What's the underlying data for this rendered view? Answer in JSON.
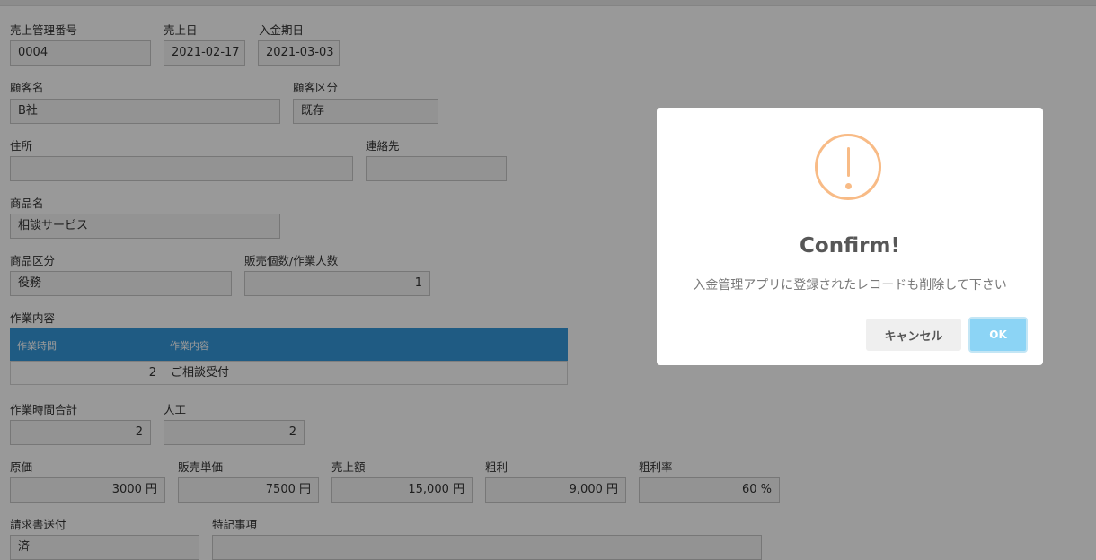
{
  "form": {
    "sales_no": {
      "label": "売上管理番号",
      "value": "0004"
    },
    "sales_date": {
      "label": "売上日",
      "value": "2021-02-17"
    },
    "due_date": {
      "label": "入金期日",
      "value": "2021-03-03"
    },
    "customer_name": {
      "label": "顧客名",
      "value": "B社"
    },
    "customer_type": {
      "label": "顧客区分",
      "value": "既存"
    },
    "address": {
      "label": "住所",
      "value": ""
    },
    "contact": {
      "label": "連絡先",
      "value": ""
    },
    "product_name": {
      "label": "商品名",
      "value": "相談サービス"
    },
    "product_type": {
      "label": "商品区分",
      "value": "役務"
    },
    "quantity": {
      "label": "販売個数/作業人数",
      "value": "1"
    },
    "work_section_label": "作業内容",
    "work_table": {
      "headers": [
        "作業時間",
        "作業内容"
      ],
      "rows": [
        {
          "hours": "2",
          "content": "ご相談受付"
        }
      ]
    },
    "total_hours": {
      "label": "作業時間合計",
      "value": "2"
    },
    "man_days": {
      "label": "人工",
      "value": "2"
    },
    "cost": {
      "label": "原価",
      "value": "3000 円"
    },
    "unit_price": {
      "label": "販売単価",
      "value": "7500 円"
    },
    "sales_amount": {
      "label": "売上額",
      "value": "15,000 円"
    },
    "gross_profit": {
      "label": "粗利",
      "value": "9,000 円"
    },
    "profit_rate": {
      "label": "粗利率",
      "value": "60 %"
    },
    "invoice_sent": {
      "label": "請求書送付",
      "value": "済"
    },
    "notes": {
      "label": "特記事項",
      "value": ""
    }
  },
  "dialog": {
    "icon": "warning-icon",
    "title": "Confirm!",
    "message": "入金管理アプリに登録されたレコードも削除して下さい",
    "cancel_label": "キャンセル",
    "ok_label": "OK"
  },
  "colors": {
    "table_header": "#3498db",
    "ok_button": "#8cd4f5",
    "warning": "#f8bb86"
  }
}
